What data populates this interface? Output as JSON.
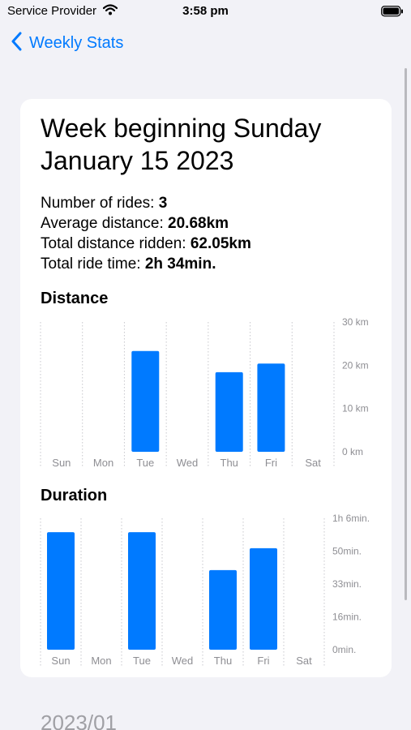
{
  "status_bar": {
    "carrier": "Service Provider",
    "time": "3:58 pm"
  },
  "nav": {
    "back_label": "Weekly Stats"
  },
  "card": {
    "title": "Week beginning Sunday January 15 2023",
    "stats": [
      {
        "label": "Number of rides: ",
        "value": "3"
      },
      {
        "label": "Average distance: ",
        "value": "20.68km"
      },
      {
        "label": "Total distance ridden: ",
        "value": "62.05km"
      },
      {
        "label": "Total ride time: ",
        "value": "2h 34min."
      }
    ]
  },
  "next_section": {
    "title": "2023/01"
  },
  "colors": {
    "accent": "#007aff",
    "bar": "#007aff",
    "background": "#f2f2f7",
    "card": "#ffffff"
  },
  "chart_data": [
    {
      "type": "bar",
      "title": "Distance",
      "categories": [
        "Sun",
        "Mon",
        "Tue",
        "Wed",
        "Thu",
        "Fri",
        "Sat"
      ],
      "values": [
        0,
        0,
        23.3,
        0,
        18.4,
        20.4,
        0
      ],
      "ylim": [
        0,
        30
      ],
      "yticks": [
        0,
        10,
        20,
        30
      ],
      "ytick_labels": [
        "0 km",
        "10 km",
        "20 km",
        "30 km"
      ],
      "grid": "vertical dotted",
      "axis_position": "right"
    },
    {
      "type": "bar",
      "title": "Duration",
      "categories": [
        "Sun",
        "Mon",
        "Tue",
        "Wed",
        "Thu",
        "Fri",
        "Sat"
      ],
      "values": [
        59,
        0,
        59,
        0,
        40,
        51,
        0
      ],
      "values_note": "",
      "ylim": [
        0,
        66
      ],
      "yticks": [
        0,
        16.5,
        33,
        49.5,
        66
      ],
      "ytick_labels": [
        "0min.",
        "16min.",
        "33min.",
        "50min.",
        "1h 6min."
      ],
      "grid": "vertical dotted",
      "axis_position": "right"
    }
  ]
}
